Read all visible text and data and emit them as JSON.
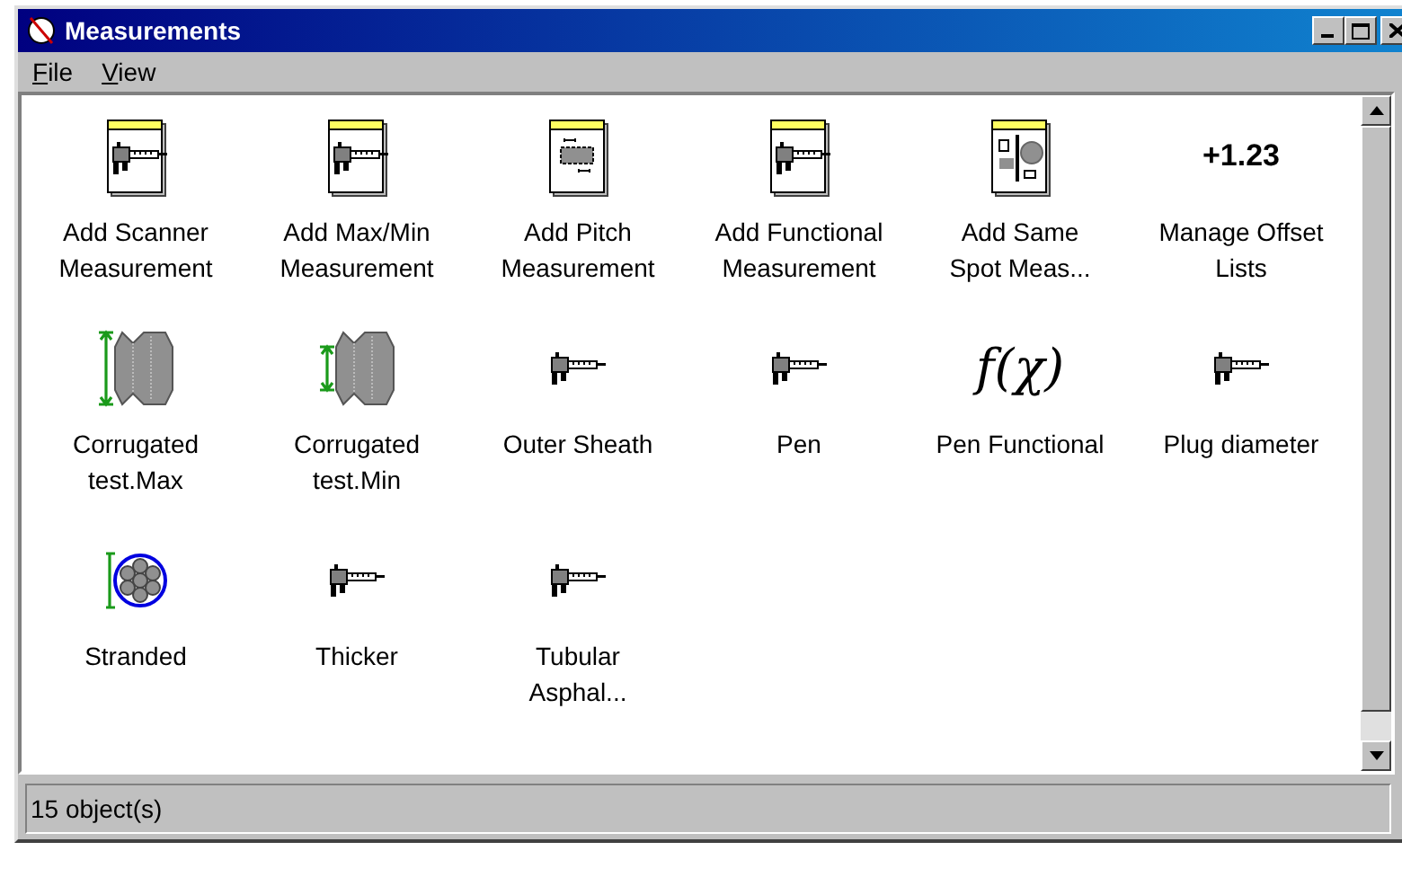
{
  "window": {
    "title": "Measurements"
  },
  "menu": [
    {
      "label": "File"
    },
    {
      "label": "View"
    }
  ],
  "items": [
    {
      "kind": "notepad-caliper",
      "label": [
        "Add Scanner",
        "Measurement"
      ]
    },
    {
      "kind": "notepad-caliper",
      "label": [
        "Add Max/Min",
        "Measurement"
      ]
    },
    {
      "kind": "notepad-pitch",
      "label": [
        "Add Pitch",
        "Measurement"
      ]
    },
    {
      "kind": "notepad-caliper",
      "label": [
        "Add Functional",
        "Measurement"
      ]
    },
    {
      "kind": "notepad-spot",
      "label": [
        "Add Same",
        "Spot Meas..."
      ]
    },
    {
      "kind": "offset",
      "icon_text": "+1.23",
      "label": [
        "Manage Offset",
        "Lists"
      ]
    },
    {
      "kind": "corrugated-max",
      "label": [
        "Corrugated",
        "test.Max"
      ]
    },
    {
      "kind": "corrugated-min",
      "label": [
        "Corrugated",
        "test.Min"
      ]
    },
    {
      "kind": "caliper",
      "label": [
        "Outer Sheath"
      ]
    },
    {
      "kind": "caliper",
      "label": [
        "Pen"
      ]
    },
    {
      "kind": "function",
      "icon_text": "f(χ)",
      "label": [
        "Pen Functional"
      ]
    },
    {
      "kind": "caliper",
      "label": [
        "Plug diameter"
      ]
    },
    {
      "kind": "stranded",
      "label": [
        "Stranded"
      ]
    },
    {
      "kind": "caliper",
      "label": [
        "Thicker"
      ]
    },
    {
      "kind": "caliper",
      "label": [
        "Tubular",
        "Asphal..."
      ]
    }
  ],
  "status_bar": "15 object(s)"
}
